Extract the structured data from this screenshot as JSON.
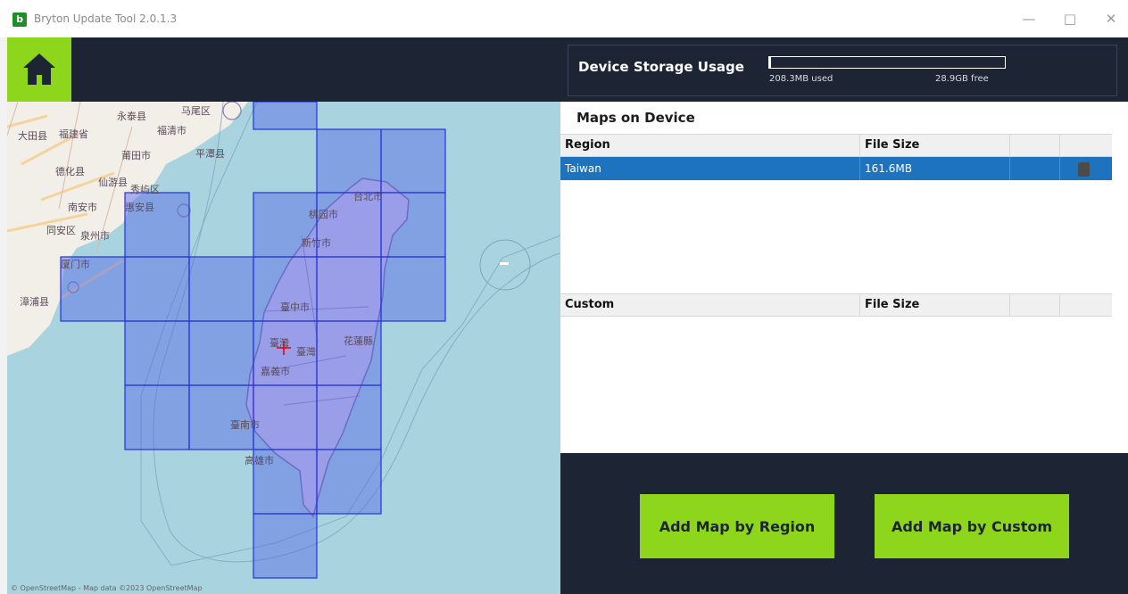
{
  "window": {
    "title": "Bryton Update Tool 2.0.1.3",
    "app_icon": "b",
    "controls": [
      "—",
      "□",
      "✕"
    ]
  },
  "topbar": {
    "home_icon": "home-icon"
  },
  "map": {
    "labels": [
      "永泰县",
      "马尾区",
      "大田县",
      "福建省",
      "福清市",
      "莆田市",
      "平潭县",
      "德化县",
      "仙游县",
      "秀屿区",
      "南安市",
      "惠安县",
      "同安区",
      "泉州市",
      "厦门市",
      "漳浦县",
      "台北市",
      "桃园市",
      "新竹市",
      "臺中市",
      "臺灣",
      "臺灣",
      "花蓮縣",
      "嘉義市",
      "臺南市",
      "高雄市"
    ],
    "attribution": "© OpenStreetMap - Map data ©2023 OpenStreetMap"
  },
  "storage": {
    "title": "Device Storage Usage",
    "used": "208.3MB used",
    "free": "28.9GB free",
    "used_fraction": 0.007
  },
  "maps_on_device": {
    "title": "Maps on Device",
    "columns": [
      "Region",
      "File Size",
      "",
      ""
    ],
    "rows": [
      {
        "region": "Taiwan",
        "size": "161.6MB"
      }
    ]
  },
  "custom": {
    "columns": [
      "Custom",
      "File Size",
      "",
      ""
    ]
  },
  "actions": {
    "add_region": "Add Map by Region",
    "add_custom": "Add Map by Custom"
  },
  "colors": {
    "navy": "#1d2535",
    "accent_green": "#8ed61b",
    "selection_blue": "#1e73be",
    "tile_fill": "#4f63e8"
  }
}
